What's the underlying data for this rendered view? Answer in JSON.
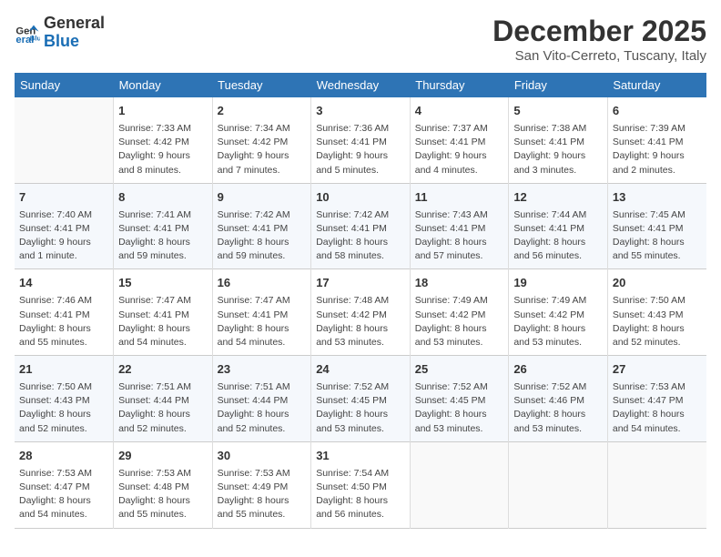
{
  "header": {
    "logo_line1": "General",
    "logo_line2": "Blue",
    "title": "December 2025",
    "subtitle": "San Vito-Cerreto, Tuscany, Italy"
  },
  "days_of_week": [
    "Sunday",
    "Monday",
    "Tuesday",
    "Wednesday",
    "Thursday",
    "Friday",
    "Saturday"
  ],
  "weeks": [
    [
      {
        "day": "",
        "info": ""
      },
      {
        "day": "1",
        "info": "Sunrise: 7:33 AM\nSunset: 4:42 PM\nDaylight: 9 hours\nand 8 minutes."
      },
      {
        "day": "2",
        "info": "Sunrise: 7:34 AM\nSunset: 4:42 PM\nDaylight: 9 hours\nand 7 minutes."
      },
      {
        "day": "3",
        "info": "Sunrise: 7:36 AM\nSunset: 4:41 PM\nDaylight: 9 hours\nand 5 minutes."
      },
      {
        "day": "4",
        "info": "Sunrise: 7:37 AM\nSunset: 4:41 PM\nDaylight: 9 hours\nand 4 minutes."
      },
      {
        "day": "5",
        "info": "Sunrise: 7:38 AM\nSunset: 4:41 PM\nDaylight: 9 hours\nand 3 minutes."
      },
      {
        "day": "6",
        "info": "Sunrise: 7:39 AM\nSunset: 4:41 PM\nDaylight: 9 hours\nand 2 minutes."
      }
    ],
    [
      {
        "day": "7",
        "info": "Sunrise: 7:40 AM\nSunset: 4:41 PM\nDaylight: 9 hours\nand 1 minute."
      },
      {
        "day": "8",
        "info": "Sunrise: 7:41 AM\nSunset: 4:41 PM\nDaylight: 8 hours\nand 59 minutes."
      },
      {
        "day": "9",
        "info": "Sunrise: 7:42 AM\nSunset: 4:41 PM\nDaylight: 8 hours\nand 59 minutes."
      },
      {
        "day": "10",
        "info": "Sunrise: 7:42 AM\nSunset: 4:41 PM\nDaylight: 8 hours\nand 58 minutes."
      },
      {
        "day": "11",
        "info": "Sunrise: 7:43 AM\nSunset: 4:41 PM\nDaylight: 8 hours\nand 57 minutes."
      },
      {
        "day": "12",
        "info": "Sunrise: 7:44 AM\nSunset: 4:41 PM\nDaylight: 8 hours\nand 56 minutes."
      },
      {
        "day": "13",
        "info": "Sunrise: 7:45 AM\nSunset: 4:41 PM\nDaylight: 8 hours\nand 55 minutes."
      }
    ],
    [
      {
        "day": "14",
        "info": "Sunrise: 7:46 AM\nSunset: 4:41 PM\nDaylight: 8 hours\nand 55 minutes."
      },
      {
        "day": "15",
        "info": "Sunrise: 7:47 AM\nSunset: 4:41 PM\nDaylight: 8 hours\nand 54 minutes."
      },
      {
        "day": "16",
        "info": "Sunrise: 7:47 AM\nSunset: 4:41 PM\nDaylight: 8 hours\nand 54 minutes."
      },
      {
        "day": "17",
        "info": "Sunrise: 7:48 AM\nSunset: 4:42 PM\nDaylight: 8 hours\nand 53 minutes."
      },
      {
        "day": "18",
        "info": "Sunrise: 7:49 AM\nSunset: 4:42 PM\nDaylight: 8 hours\nand 53 minutes."
      },
      {
        "day": "19",
        "info": "Sunrise: 7:49 AM\nSunset: 4:42 PM\nDaylight: 8 hours\nand 53 minutes."
      },
      {
        "day": "20",
        "info": "Sunrise: 7:50 AM\nSunset: 4:43 PM\nDaylight: 8 hours\nand 52 minutes."
      }
    ],
    [
      {
        "day": "21",
        "info": "Sunrise: 7:50 AM\nSunset: 4:43 PM\nDaylight: 8 hours\nand 52 minutes."
      },
      {
        "day": "22",
        "info": "Sunrise: 7:51 AM\nSunset: 4:44 PM\nDaylight: 8 hours\nand 52 minutes."
      },
      {
        "day": "23",
        "info": "Sunrise: 7:51 AM\nSunset: 4:44 PM\nDaylight: 8 hours\nand 52 minutes."
      },
      {
        "day": "24",
        "info": "Sunrise: 7:52 AM\nSunset: 4:45 PM\nDaylight: 8 hours\nand 53 minutes."
      },
      {
        "day": "25",
        "info": "Sunrise: 7:52 AM\nSunset: 4:45 PM\nDaylight: 8 hours\nand 53 minutes."
      },
      {
        "day": "26",
        "info": "Sunrise: 7:52 AM\nSunset: 4:46 PM\nDaylight: 8 hours\nand 53 minutes."
      },
      {
        "day": "27",
        "info": "Sunrise: 7:53 AM\nSunset: 4:47 PM\nDaylight: 8 hours\nand 54 minutes."
      }
    ],
    [
      {
        "day": "28",
        "info": "Sunrise: 7:53 AM\nSunset: 4:47 PM\nDaylight: 8 hours\nand 54 minutes."
      },
      {
        "day": "29",
        "info": "Sunrise: 7:53 AM\nSunset: 4:48 PM\nDaylight: 8 hours\nand 55 minutes."
      },
      {
        "day": "30",
        "info": "Sunrise: 7:53 AM\nSunset: 4:49 PM\nDaylight: 8 hours\nand 55 minutes."
      },
      {
        "day": "31",
        "info": "Sunrise: 7:54 AM\nSunset: 4:50 PM\nDaylight: 8 hours\nand 56 minutes."
      },
      {
        "day": "",
        "info": ""
      },
      {
        "day": "",
        "info": ""
      },
      {
        "day": "",
        "info": ""
      }
    ]
  ]
}
